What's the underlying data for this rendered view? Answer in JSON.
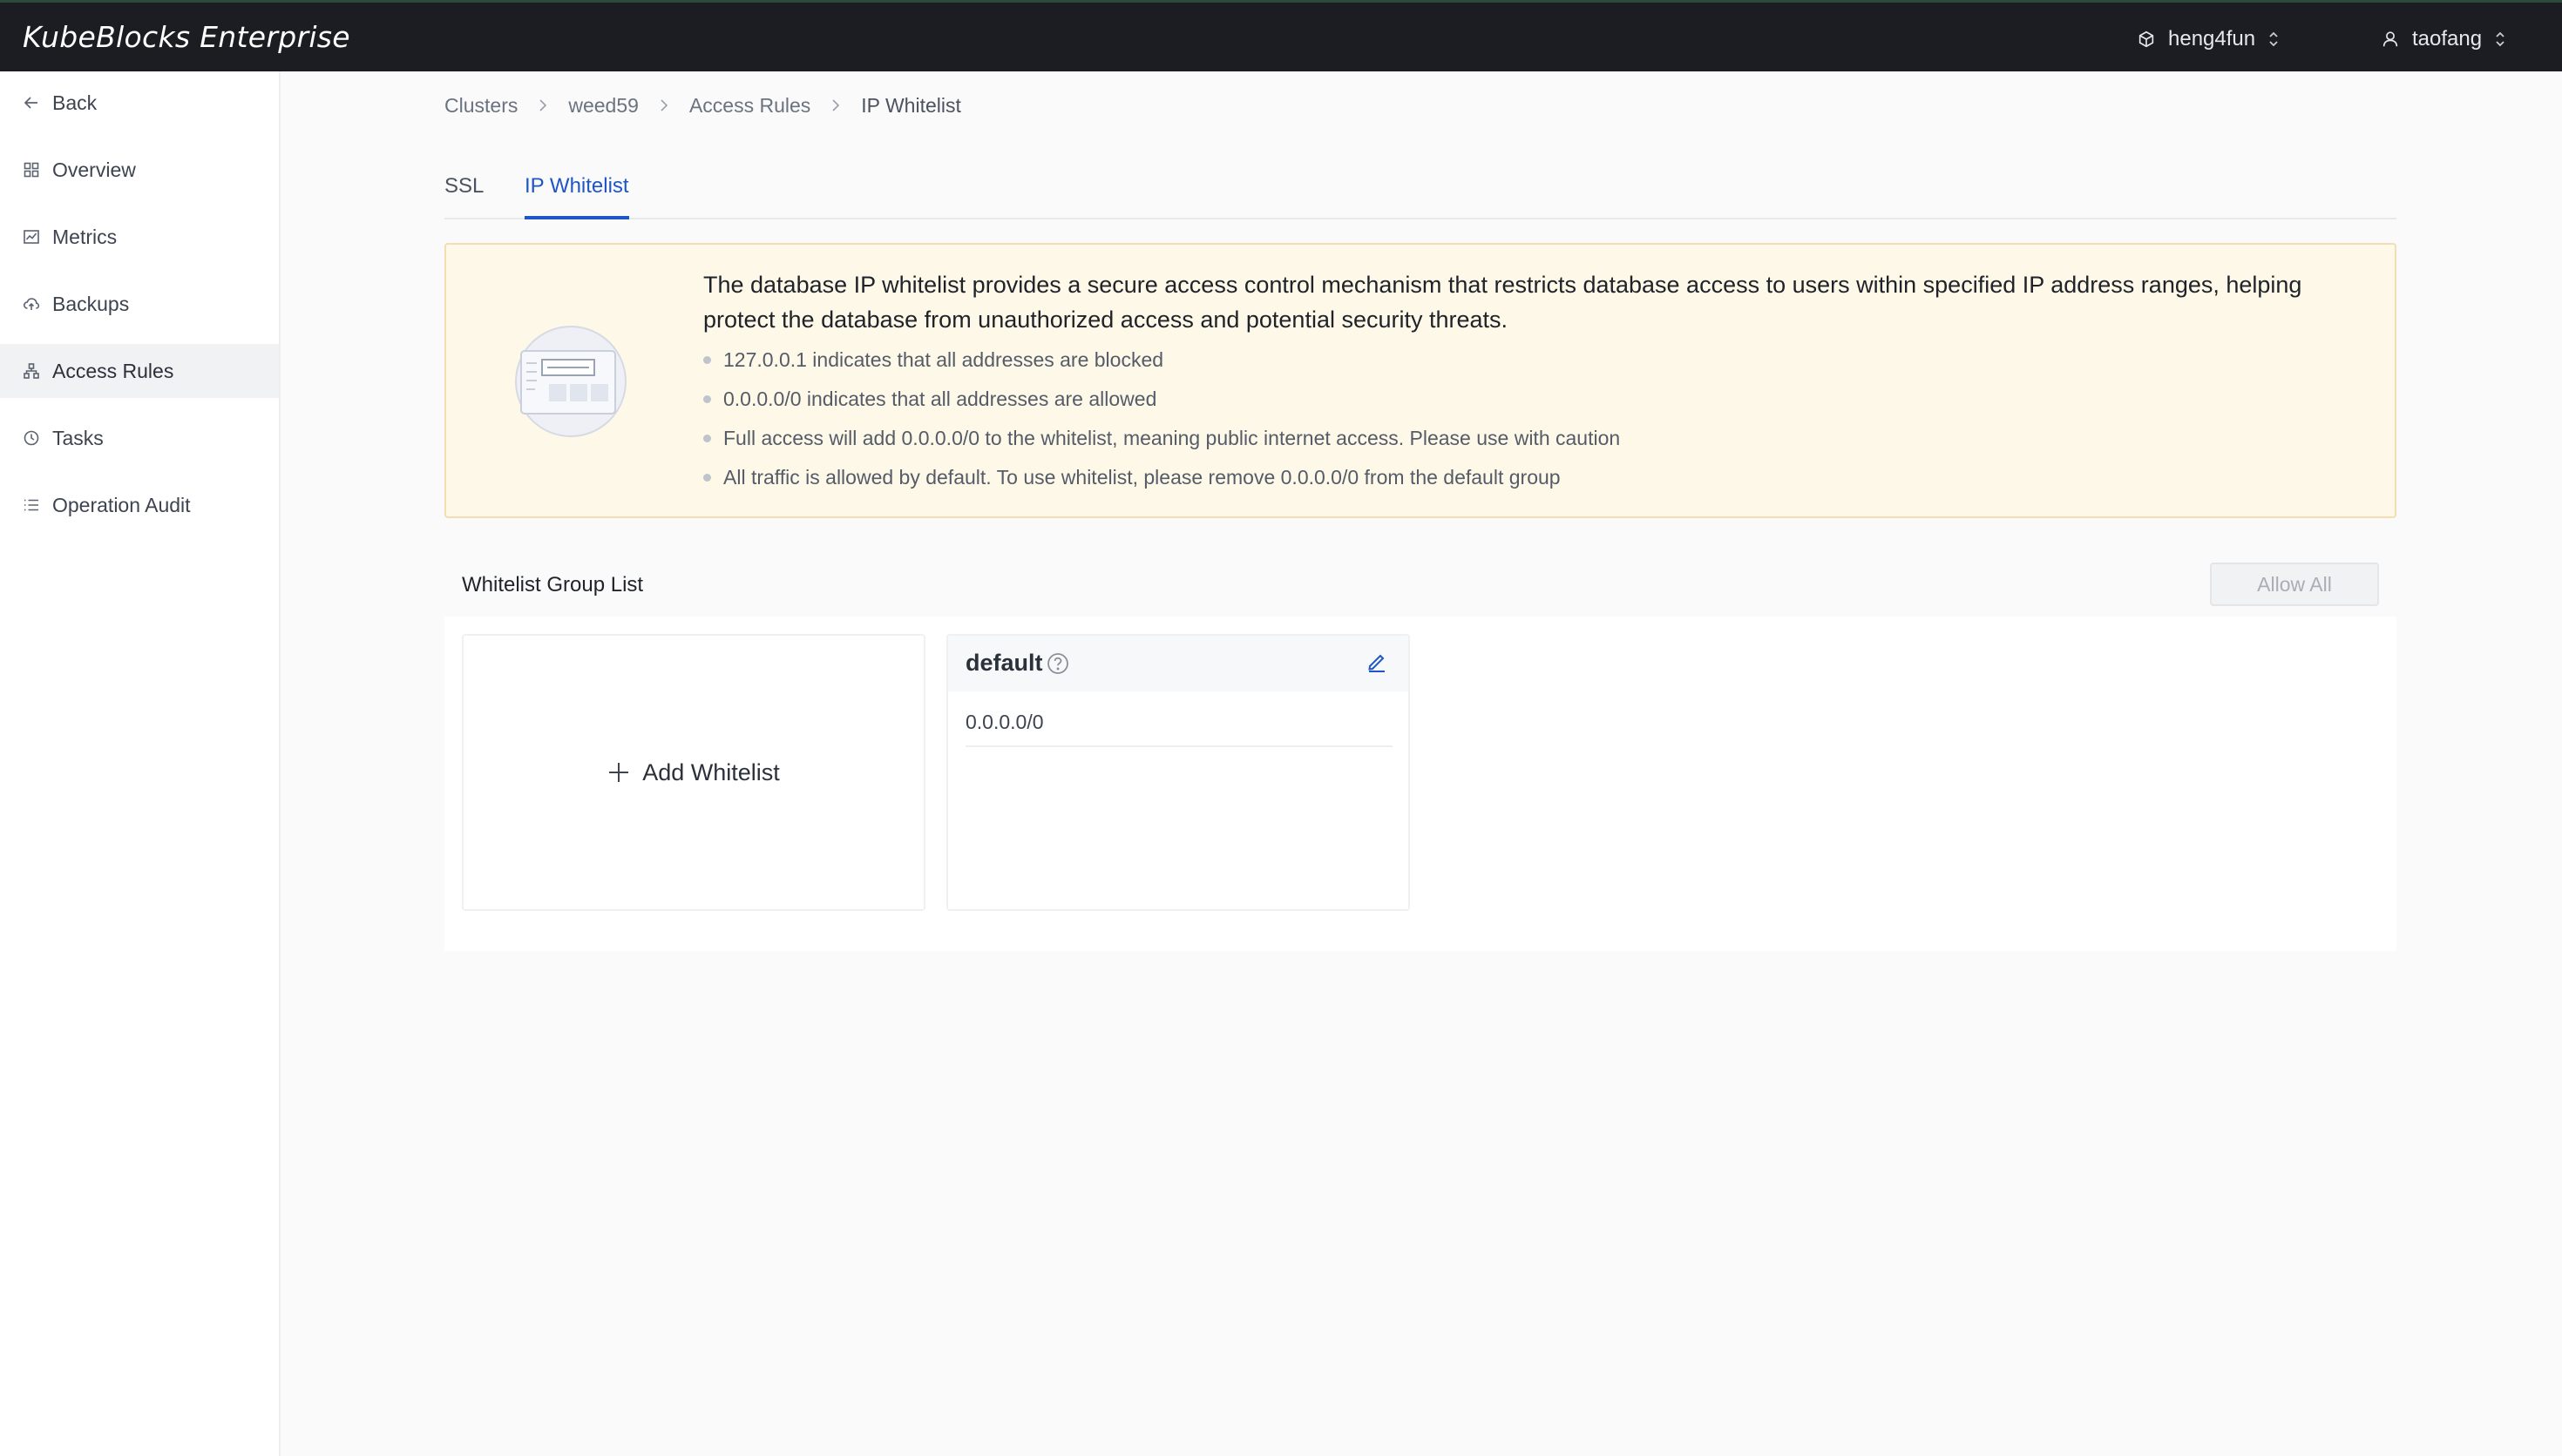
{
  "app": {
    "brand": "KubeBlocks Enterprise",
    "org": "heng4fun",
    "user": "taofang"
  },
  "sidebar": {
    "items": [
      {
        "label": "Back",
        "icon": "arrow-left-icon"
      },
      {
        "label": "Overview",
        "icon": "grid-icon"
      },
      {
        "label": "Metrics",
        "icon": "chart-icon"
      },
      {
        "label": "Backups",
        "icon": "cloud-upload-icon"
      },
      {
        "label": "Access Rules",
        "icon": "network-icon",
        "active": true
      },
      {
        "label": "Tasks",
        "icon": "clock-icon"
      },
      {
        "label": "Operation Audit",
        "icon": "list-icon"
      }
    ]
  },
  "breadcrumb": [
    "Clusters",
    "weed59",
    "Access Rules",
    "IP Whitelist"
  ],
  "tabs": [
    {
      "label": "SSL"
    },
    {
      "label": "IP Whitelist",
      "active": true
    }
  ],
  "notice": {
    "title": "The database IP whitelist provides a secure access control mechanism that restricts database access to users within specified IP address ranges, helping protect the database from unauthorized access and potential security threats.",
    "items": [
      "127.0.0.1 indicates that all addresses are blocked",
      "0.0.0.0/0 indicates that all addresses are allowed",
      "Full access will add 0.0.0.0/0 to the whitelist, meaning public internet access. Please use with caution",
      "All traffic is allowed by default. To use whitelist, please remove 0.0.0.0/0 from the default group"
    ]
  },
  "whitelist": {
    "section_title": "Whitelist Group List",
    "allow_all_label": "Allow All",
    "add_label": "Add Whitelist",
    "groups": [
      {
        "name": "default",
        "ips": [
          "0.0.0.0/0"
        ]
      }
    ]
  },
  "colors": {
    "topbar": "#1b1d22",
    "accent": "#1f56c7",
    "notice_bg": "#fdf8e7",
    "notice_border": "#f4ddb2"
  }
}
